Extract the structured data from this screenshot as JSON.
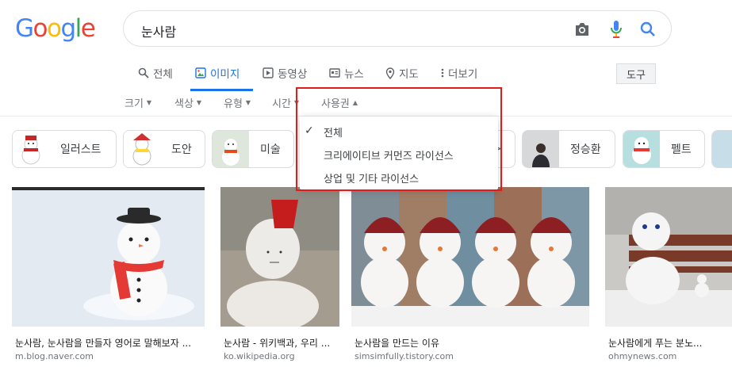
{
  "logo": {
    "text": [
      "G",
      "o",
      "o",
      "g",
      "l",
      "e"
    ],
    "colors": [
      "#4285F4",
      "#EA4335",
      "#FBBC05",
      "#4285F4",
      "#34A853",
      "#EA4335"
    ]
  },
  "search": {
    "query": "눈사람"
  },
  "tabs": [
    {
      "label": "전체",
      "icon": "search-icon"
    },
    {
      "label": "이미지",
      "icon": "image-icon",
      "active": true
    },
    {
      "label": "동영상",
      "icon": "play-icon"
    },
    {
      "label": "뉴스",
      "icon": "news-icon"
    },
    {
      "label": "지도",
      "icon": "map-pin-icon"
    },
    {
      "label": "더보기",
      "icon": "more-vert-icon"
    }
  ],
  "tools_label": "도구",
  "filters": [
    {
      "label": "크기"
    },
    {
      "label": "색상"
    },
    {
      "label": "유형"
    },
    {
      "label": "시간"
    },
    {
      "label": "사용권",
      "open": true
    }
  ],
  "license_menu": {
    "items": [
      "전체",
      "크리에이티브 커먼즈 라이선스",
      "상업 및 기타 라이선스"
    ],
    "selected": "전체"
  },
  "chips": [
    {
      "label": "일러스트"
    },
    {
      "label": "도안"
    },
    {
      "label": "미술"
    },
    {
      "label": "정승환"
    },
    {
      "label": "펠트"
    }
  ],
  "results": [
    {
      "title": "눈사람, 눈사람을 만들자 영어로 말해보자 ...",
      "source": "m.blog.naver.com"
    },
    {
      "title": "눈사람 - 위키백과, 우리 ...",
      "source": "ko.wikipedia.org"
    },
    {
      "title": "눈사람을 만드는 이유",
      "source": "simsimfully.tistory.com"
    },
    {
      "title": "눈사람에게 푸는 분노...",
      "source": "ohmynews.com"
    }
  ],
  "accent_color": "#1a73e8",
  "highlight_color": "#e21b1b"
}
